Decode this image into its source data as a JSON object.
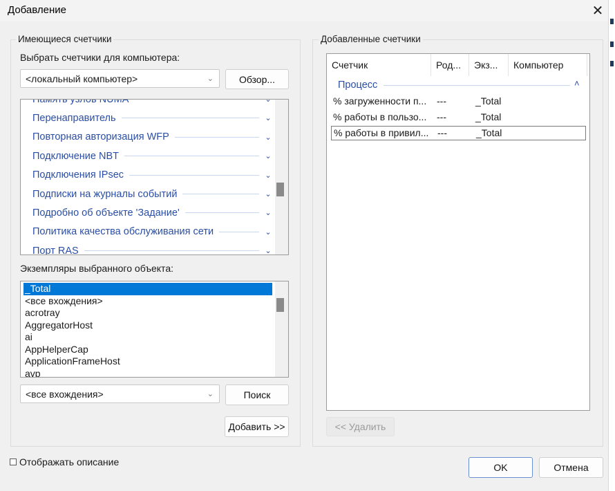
{
  "window": {
    "title": "Добавление",
    "close_icon": "close-icon"
  },
  "available": {
    "group_title": "Имеющиеся счетчики",
    "select_label": "Выбрать счетчики для компьютера:",
    "computer_value": "<локальный компьютер>",
    "browse_label": "Обзор...",
    "objects": [
      "Память узлов NUMA",
      "Перенаправитель",
      "Повторная авторизация WFP",
      "Подключение NBT",
      "Подключения IPsec",
      "Подписки на журналы событий",
      "Подробно об объекте 'Задание'",
      "Политика качества обслуживания сети",
      "Порт RAS"
    ],
    "instances_label": "Экземпляры выбранного объекта:",
    "instances": [
      "_Total",
      "<все вхождения>",
      "acrotray",
      "AggregatorHost",
      "ai",
      "AppHelperCap",
      "ApplicationFrameHost",
      "avp"
    ],
    "selected_instance": "_Total",
    "search_value": "<все вхождения>",
    "search_button": "Поиск",
    "add_button": "Добавить >>"
  },
  "added": {
    "group_title": "Добавленные счетчики",
    "columns": [
      "Счетчик",
      "Род...",
      "Экз...",
      "Компьютер"
    ],
    "group_name": "Процесс",
    "rows": [
      {
        "counter": "% загруженности п...",
        "parent": "---",
        "instance": "_Total",
        "computer": ""
      },
      {
        "counter": "% работы в пользо...",
        "parent": "---",
        "instance": "_Total",
        "computer": ""
      },
      {
        "counter": "% работы в привил...",
        "parent": "---",
        "instance": "_Total",
        "computer": ""
      }
    ],
    "remove_button": "<< Удалить"
  },
  "footer": {
    "show_description": "Отображать описание",
    "show_description_checked": false,
    "ok": "OK",
    "cancel": "Отмена"
  },
  "colors": {
    "accent": "#0078d7",
    "object_text": "#2a4ea5"
  }
}
